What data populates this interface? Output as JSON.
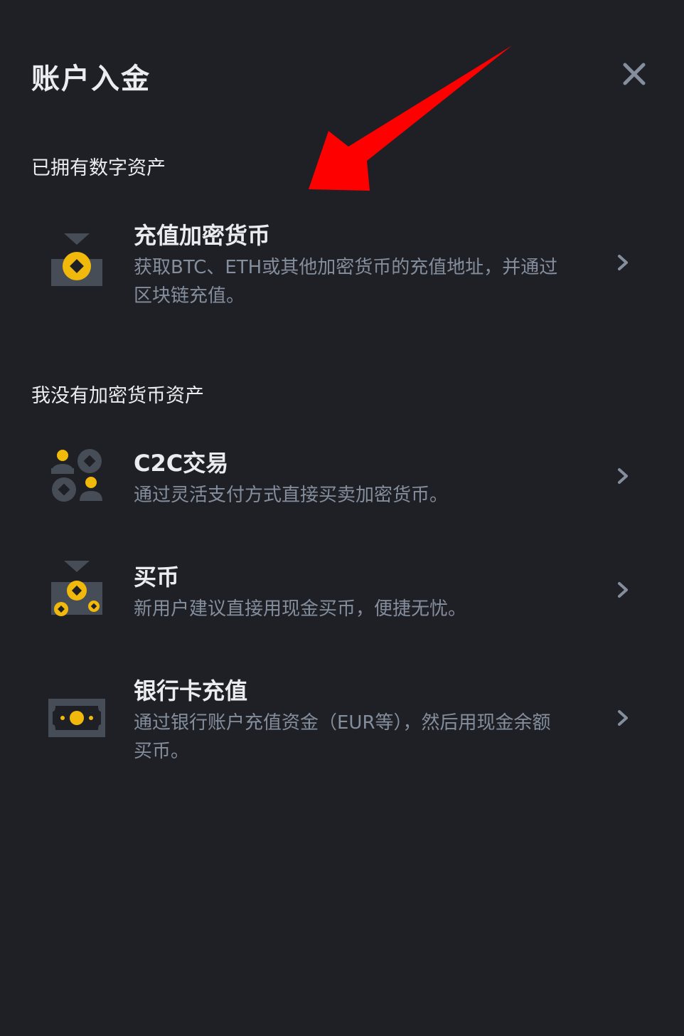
{
  "header": {
    "title": "账户入金",
    "close_icon": "close-icon"
  },
  "sections": [
    {
      "label": "已拥有数字资产",
      "items": [
        {
          "title": "充值加密货币",
          "description": "获取BTC、ETH或其他加密货币的充值地址，并通过区块链充值。",
          "icon": "deposit-crypto-icon"
        }
      ]
    },
    {
      "label": "我没有加密货币资产",
      "items": [
        {
          "title": "C2C交易",
          "description": "通过灵活支付方式直接买卖加密货币。",
          "icon": "c2c-trade-icon"
        },
        {
          "title": "买币",
          "description": "新用户建议直接用现金买币，便捷无忧。",
          "icon": "buy-crypto-icon"
        },
        {
          "title": "银行卡充值",
          "description": "通过银行账户充值资金（EUR等），然后用现金余额买币。",
          "icon": "bank-card-icon"
        }
      ]
    }
  ],
  "colors": {
    "background": "#1f2026",
    "accent": "#f0b90b",
    "icon_gray": "#474d57",
    "annotation_arrow": "#ff0000"
  }
}
